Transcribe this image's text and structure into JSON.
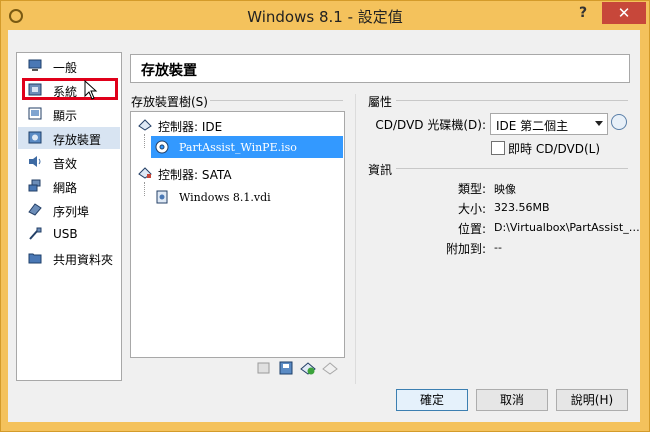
{
  "window": {
    "title": "Windows 8.1 - 設定值",
    "help_label": "?",
    "close_label": "✕"
  },
  "sidebar": {
    "items": [
      {
        "label": "一般",
        "icon": "general-icon"
      },
      {
        "label": "系統",
        "icon": "system-icon"
      },
      {
        "label": "顯示",
        "icon": "display-icon"
      },
      {
        "label": "存放裝置",
        "icon": "storage-icon",
        "selected": true
      },
      {
        "label": "音效",
        "icon": "audio-icon"
      },
      {
        "label": "網路",
        "icon": "network-icon"
      },
      {
        "label": "序列埠",
        "icon": "serial-port-icon"
      },
      {
        "label": "USB",
        "icon": "usb-icon"
      },
      {
        "label": "共用資料夾",
        "icon": "shared-folder-icon"
      }
    ],
    "highlighted": "系統"
  },
  "page": {
    "title": "存放裝置"
  },
  "tree": {
    "label": "存放裝置樹(S)",
    "rows": [
      {
        "label": "控制器: IDE",
        "kind": "controller"
      },
      {
        "label": "PartAssist_WinPE.iso",
        "kind": "disc",
        "selected": true
      },
      {
        "label": "控制器: SATA",
        "kind": "controller"
      },
      {
        "label": "Windows 8.1.vdi",
        "kind": "disk"
      }
    ]
  },
  "attributes": {
    "section_label": "屬性",
    "drive_label": "CD/DVD 光碟機(D):",
    "drive_value": "IDE 第二個主",
    "live_cd_label": "即時 CD/DVD(L)",
    "live_cd_checked": false
  },
  "info": {
    "section_label": "資訊",
    "type_label": "類型:",
    "type_value": "映像",
    "size_label": "大小:",
    "size_value": "323.56MB",
    "location_label": "位置:",
    "location_value": "D:\\Virtualbox\\PartAssist_…",
    "attached_label": "附加到:",
    "attached_value": "--"
  },
  "buttons": {
    "ok": "確定",
    "cancel": "取消",
    "help": "說明(H)"
  },
  "colors": {
    "title_bar": "#f4c25c",
    "selection": "#3399ff",
    "highlight_box": "#e0001a",
    "close_button": "#c7473a"
  }
}
